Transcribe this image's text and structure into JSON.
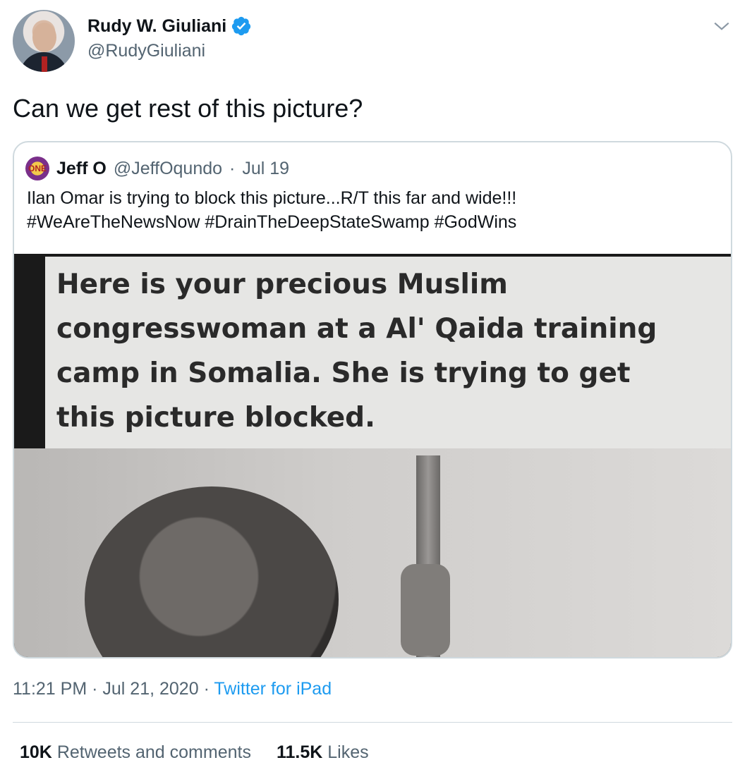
{
  "author": {
    "name": "Rudy W. Giuliani",
    "handle": "@RudyGiuliani",
    "verified_icon": "verified-badge-icon"
  },
  "tweet": {
    "text": "Can we get rest of this picture?"
  },
  "quote": {
    "name": "Jeff O",
    "handle": "@JeffOqundo",
    "separator": "·",
    "date": "Jul 19",
    "avatar_text": "ONE",
    "text_line1": "Ilan Omar is trying to block this picture...R/T this far and wide!!!",
    "text_line2": "#WeAreTheNewsNow  #DrainTheDeepStateSwamp #GodWins",
    "image_caption": "Here is your precious Muslim\ncongresswoman at a Al' Qaida training\ncamp in Somalia. She is trying to get\nthis picture blocked."
  },
  "meta": {
    "time": "11:21 PM",
    "sep1": "·",
    "date": "Jul 21, 2020",
    "sep2": "·",
    "source": "Twitter for iPad"
  },
  "stats": {
    "retweets_count": "10K",
    "retweets_label": "Retweets and comments",
    "likes_count": "11.5K",
    "likes_label": "Likes"
  },
  "colors": {
    "link": "#1d9bf0",
    "secondary_text": "#536471",
    "primary_text": "#0f1419"
  }
}
